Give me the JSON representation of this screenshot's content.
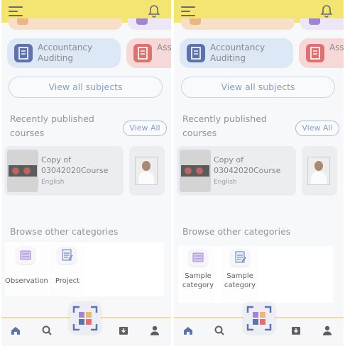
{
  "left": {
    "subjects": [
      {
        "line1": "Accountancy",
        "line2": "Auditing",
        "bg": "#cfe0f2",
        "icon_bg": "#1f3d8a"
      },
      {
        "line1": "Ass",
        "line2": "",
        "bg": "#f4c9c9",
        "icon_bg": "#cf3b3b"
      }
    ],
    "view_all_subjects": "View all subjects",
    "recently_published": "Recently published courses",
    "view_all": "View All",
    "course": {
      "line1": "Copy of",
      "line2": "03042020Course",
      "language": "English"
    },
    "browse_title": "Browse other categories",
    "categories": [
      {
        "label": "Observation",
        "icon": "observation-icon"
      },
      {
        "label": "Project",
        "icon": "project-icon"
      }
    ]
  },
  "right": {
    "subjects": [
      {
        "line1": "Accountancy",
        "line2": "Auditing",
        "bg": "#cfe0f2",
        "icon_bg": "#1f3d8a"
      },
      {
        "line1": "Ass",
        "line2": "",
        "bg": "#f4c9c9",
        "icon_bg": "#cf3b3b"
      }
    ],
    "view_all_subjects": "View all subjects",
    "recently_published": "Recently published courses",
    "view_all": "View All",
    "course": {
      "line1": "Copy of",
      "line2": "03042020Course",
      "language": "English"
    },
    "browse_title": "Browse other categories",
    "categories": [
      {
        "label": "Sample category",
        "icon": "sample-category-icon"
      },
      {
        "label": "Sample category",
        "icon": "sample-category-icon"
      }
    ]
  },
  "colors": {
    "header": "#f0da3c",
    "accent": "#5d79a8",
    "nav_icon": "#1f3d8a"
  },
  "nav_icons": [
    "home-icon",
    "search-icon",
    "qr-scan-icon",
    "download-icon",
    "profile-icon"
  ]
}
